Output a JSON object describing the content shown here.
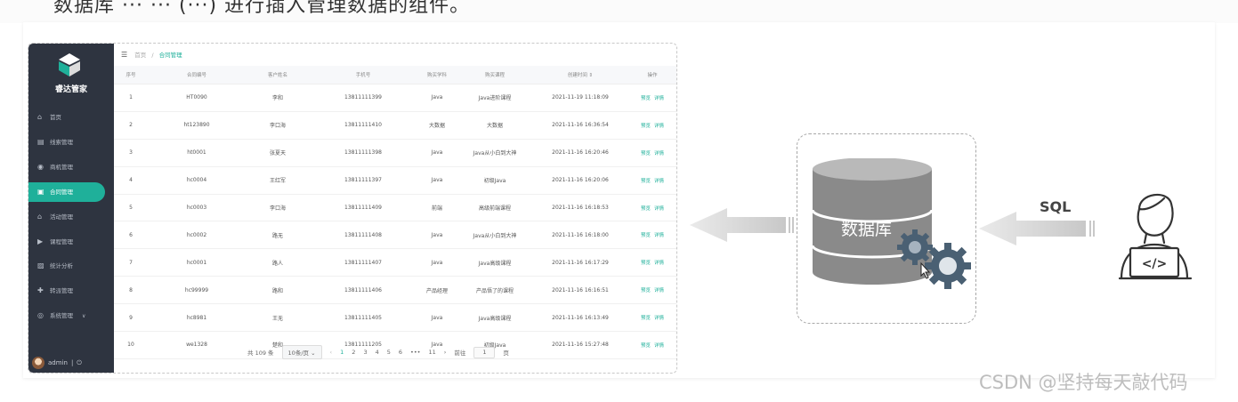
{
  "top_caption": "数据库 ··· ··· (···) 进行插入管理数据的组件。",
  "app": {
    "brand": "睿达管家",
    "nav": [
      {
        "label": "首页",
        "icon": "home-icon",
        "glyph": "⌂"
      },
      {
        "label": "线索管理",
        "icon": "clue-icon",
        "glyph": "▤"
      },
      {
        "label": "商机管理",
        "icon": "opportunity-icon",
        "glyph": "◉"
      },
      {
        "label": "合同管理",
        "icon": "contract-icon",
        "glyph": "▣",
        "active": true
      },
      {
        "label": "活动管理",
        "icon": "activity-icon",
        "glyph": "⌂"
      },
      {
        "label": "课程管理",
        "icon": "course-icon",
        "glyph": "▶"
      },
      {
        "label": "统计分析",
        "icon": "stats-icon",
        "glyph": "▨"
      },
      {
        "label": "转派管理",
        "icon": "transfer-icon",
        "glyph": "✚"
      },
      {
        "label": "系统管理",
        "icon": "system-icon",
        "glyph": "◎",
        "arrow": "∨"
      }
    ],
    "user": {
      "name": "admin",
      "separator": "|",
      "logout_icon": "⏻"
    },
    "breadcrumb": {
      "home": "首页",
      "sep": "/",
      "current": "合同管理"
    },
    "table": {
      "headers": [
        "序号",
        "合同编号",
        "客户姓名",
        "手机号",
        "购买学科",
        "购买课程",
        "创建时间 ⇕",
        "操作"
      ],
      "actions": [
        "预览",
        "详情"
      ],
      "rows": [
        [
          "1",
          "HT0090",
          "李和",
          "13811111399",
          "Java",
          "Java进阶课程",
          "2021-11-19 11:18:09"
        ],
        [
          "2",
          "ht123890",
          "李口海",
          "13811111410",
          "大数据",
          "大数据",
          "2021-11-16 16:36:54"
        ],
        [
          "3",
          "ht0001",
          "张夏天",
          "13811111398",
          "Java",
          "Java从小白到大神",
          "2021-11-16 16:20:46"
        ],
        [
          "4",
          "hc0004",
          "王红军",
          "13811111397",
          "Java",
          "初级Java",
          "2021-11-16 16:20:06"
        ],
        [
          "5",
          "hc0003",
          "李口海",
          "13811111409",
          "前端",
          "高级前端课程",
          "2021-11-16 16:18:53"
        ],
        [
          "6",
          "hc0002",
          "路无",
          "13811111408",
          "Java",
          "Java从小白到大神",
          "2021-11-16 16:18:00"
        ],
        [
          "7",
          "hc0001",
          "路人",
          "13811111407",
          "Java",
          "Java高级课程",
          "2021-11-16 16:17:29"
        ],
        [
          "8",
          "hc99999",
          "路和",
          "13811111406",
          "产品经理",
          "产品悟了的课程",
          "2021-11-16 16:16:51"
        ],
        [
          "9",
          "hc8981",
          "王无",
          "13811111405",
          "Java",
          "Java高级课程",
          "2021-11-16 16:13:49"
        ],
        [
          "10",
          "we1328",
          "楚和",
          "13811111205",
          "Java",
          "初级Java",
          "2021-11-16 15:27:48"
        ]
      ]
    },
    "pager": {
      "total": "共 109 条",
      "page_size": "10条/页",
      "prev": "‹",
      "pages": [
        "1",
        "2",
        "3",
        "4",
        "5",
        "6",
        "•••",
        "11"
      ],
      "next": "›",
      "goto_label": "前往",
      "goto_value": "1",
      "goto_unit": "页"
    }
  },
  "diagram": {
    "db_label": "数据库",
    "sql_label": "SQL",
    "code_icon_text": "</>",
    "colors": {
      "db": "#8a8a8a",
      "gear": "#4a6073",
      "arrow": "#cfcfcf",
      "accent": "#1fb09a"
    }
  },
  "watermark": "CSDN @坚持每天敲代码"
}
